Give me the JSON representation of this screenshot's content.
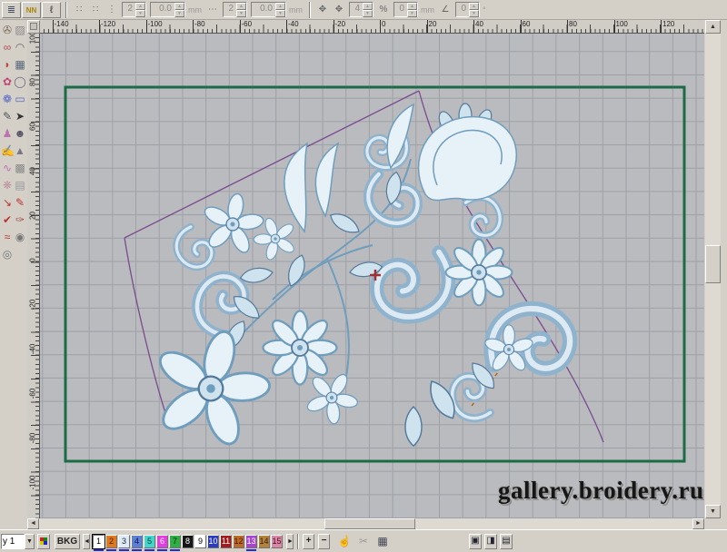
{
  "window": {
    "chrome_color": "#d4d0c8",
    "canvas_color": "#babbbe",
    "grid_color": "#9da0a7"
  },
  "toolbar": {
    "buttons": [
      {
        "name": "stitch-marks-tool",
        "glyph": "≣",
        "color": "#445066"
      },
      {
        "name": "density-tool",
        "glyph": "NN",
        "color": "#a8860a"
      },
      {
        "name": "length-curve-tool",
        "glyph": "ℓ",
        "color": "#333333"
      }
    ],
    "mini_icons": {
      "dots1": "∷",
      "dots2": "∷",
      "vdots": "⋮",
      "ellipsis": "⋯",
      "move1": "✥",
      "move2": "✥",
      "percent": "%",
      "angle": "∠"
    },
    "fields": [
      {
        "value": "2",
        "unit": ""
      },
      {
        "value": "0.0",
        "unit": "mm"
      },
      {
        "value": "2",
        "unit": ""
      },
      {
        "value": "0.0",
        "unit": "mm"
      },
      {
        "value": "4",
        "unit": ""
      },
      {
        "value": "0",
        "unit": "mm"
      },
      {
        "value": "0",
        "unit": "°"
      }
    ]
  },
  "left_toolbar": {
    "icons": [
      {
        "name": "lasso-tool",
        "glyph": "✇",
        "color": "#7a6a5a"
      },
      {
        "name": "hatch-tool",
        "glyph": "▨",
        "color": "#8a8a8a"
      },
      {
        "name": "thread-loop-tool",
        "glyph": "∞",
        "color": "#b05050"
      },
      {
        "name": "curve-tool",
        "glyph": "◠",
        "color": "#666666"
      },
      {
        "name": "bean-stitch-tool",
        "glyph": "◗",
        "color": "#c04848"
      },
      {
        "name": "image-tool",
        "glyph": "▦",
        "color": "#556677"
      },
      {
        "name": "flower-tool",
        "glyph": "✿",
        "color": "#c04878"
      },
      {
        "name": "ellipse-tool",
        "glyph": "◯",
        "color": "#666677"
      },
      {
        "name": "petal-tool",
        "glyph": "❁",
        "color": "#5868c8"
      },
      {
        "name": "rect-tool",
        "glyph": "▭",
        "color": "#5868c8"
      },
      {
        "name": "pencil-tool",
        "glyph": "✎",
        "color": "#555555"
      },
      {
        "name": "bird-tool",
        "glyph": "➤",
        "color": "#333333"
      },
      {
        "name": "figure-tool",
        "glyph": "♟",
        "color": "#c070b0"
      },
      {
        "name": "people-tool",
        "glyph": "☻",
        "color": "#555566"
      },
      {
        "name": "hand-draw-tool",
        "glyph": "✍",
        "color": "#7a6a5a"
      },
      {
        "name": "mountain-tool",
        "glyph": "▲",
        "color": "#777788"
      },
      {
        "name": "swirl-tool",
        "glyph": "∿",
        "color": "#c070b0"
      },
      {
        "name": "pattern-tool",
        "glyph": "▩",
        "color": "#888888"
      },
      {
        "name": "spray-tool",
        "glyph": "❋",
        "color": "#c090a0"
      },
      {
        "name": "texture-tool",
        "glyph": "▤",
        "color": "#999999"
      },
      {
        "name": "red-arrow-tool",
        "glyph": "↘",
        "color": "#c03030"
      },
      {
        "name": "red-pencil-tool",
        "glyph": "✎",
        "color": "#c03030"
      },
      {
        "name": "check-tool",
        "glyph": "✔",
        "color": "#c03030"
      },
      {
        "name": "dot-pencil-tool",
        "glyph": "✑",
        "color": "#a05050"
      },
      {
        "name": "scribble-tool",
        "glyph": "≈",
        "color": "#c03030"
      },
      {
        "name": "rings-tool",
        "glyph": "◉",
        "color": "#777777"
      },
      {
        "name": "ring-tool",
        "glyph": "◎",
        "color": "#777777"
      }
    ]
  },
  "rulers": {
    "top_labels": [
      -140,
      -120,
      -100,
      -80,
      -60,
      -40,
      -20,
      0,
      20,
      40,
      60,
      80,
      100,
      120
    ],
    "left_labels": [
      100,
      80,
      60,
      40,
      20,
      0,
      -20,
      -40,
      -60,
      -80,
      -100
    ]
  },
  "canvas": {
    "watermark": "gallery.broidery.ru",
    "hoop_color": "#1b6b44",
    "outline_color": "#7a4b8f",
    "design_fill": "#cfe3ee",
    "design_stroke": "#54799b"
  },
  "scrollbars": {
    "up": "▲",
    "down": "▼",
    "left": "◄",
    "right": "►"
  },
  "bottom_bar": {
    "selector_value": "y 1",
    "selector_arrow": "▼",
    "bkg_label": "BKG",
    "scroll_left": "◄",
    "scroll_right": "►",
    "add_label": "+",
    "remove_label": "−",
    "hand_glyph": "☝",
    "scissors_glyph": "✂",
    "grid_glyph": "▦",
    "view_buttons": [
      {
        "name": "view-button-1",
        "glyph": "▣"
      },
      {
        "name": "view-button-2",
        "glyph": "◨"
      },
      {
        "name": "view-button-3",
        "glyph": "▤"
      }
    ],
    "swatches": [
      {
        "n": "1",
        "color": "#ffffff",
        "text": "#000000",
        "selected": true,
        "underline": true
      },
      {
        "n": "2",
        "color": "#e0781e",
        "text": "#402000",
        "underline": true
      },
      {
        "n": "3",
        "color": "#dcebf5",
        "text": "#203040",
        "underline": true
      },
      {
        "n": "4",
        "color": "#5b7fd6",
        "text": "#101840",
        "underline": true
      },
      {
        "n": "5",
        "color": "#3fd6cc",
        "text": "#103830",
        "underline": true
      },
      {
        "n": "6",
        "color": "#e23ce2",
        "text": "#ffffff",
        "underline": true
      },
      {
        "n": "7",
        "color": "#2fae43",
        "text": "#0a2e12",
        "underline": true
      },
      {
        "n": "8",
        "color": "#161616",
        "text": "#ffffff"
      },
      {
        "n": "9",
        "color": "#ffffff",
        "text": "#000000"
      },
      {
        "n": "10",
        "color": "#2b3bbf",
        "text": "#ffffff"
      },
      {
        "n": "11",
        "color": "#a51c1c",
        "text": "#ffffff"
      },
      {
        "n": "12",
        "color": "#c06a28",
        "text": "#3a1a05"
      },
      {
        "n": "13",
        "color": "#a944cf",
        "text": "#ffffff",
        "underline": true
      },
      {
        "n": "14",
        "color": "#b5823d",
        "text": "#2e1c05"
      },
      {
        "n": "15",
        "color": "#dc87a5",
        "text": "#40101c"
      }
    ]
  }
}
